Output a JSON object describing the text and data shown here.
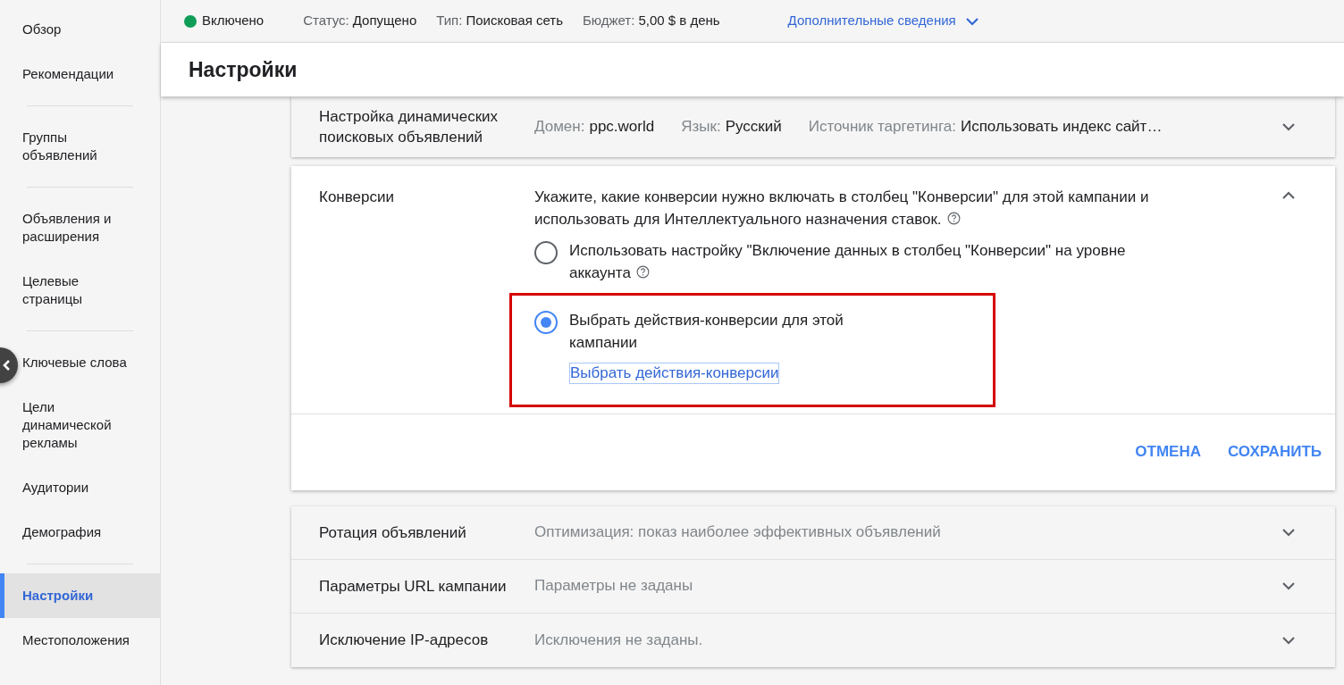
{
  "status_bar": {
    "state": {
      "label": "Включено",
      "color": "#0f9d58"
    },
    "fields": [
      {
        "label": "Статус:",
        "value": "Допущено"
      },
      {
        "label": "Тип:",
        "value": "Поисковая сеть"
      },
      {
        "label": "Бюджет:",
        "value": "5,00 $ в день"
      }
    ],
    "more_link": "Дополнительные сведения"
  },
  "sidebar": {
    "groups": [
      [
        {
          "label": "Обзор",
          "selected": false
        },
        {
          "label": "Рекомендации",
          "selected": false
        }
      ],
      [
        {
          "label": "Группы объявлений",
          "selected": false
        }
      ],
      [
        {
          "label": "Объявления и расширения",
          "selected": false
        },
        {
          "label": "Целевые страницы",
          "selected": false
        }
      ],
      [
        {
          "label": "Ключевые слова",
          "selected": false
        },
        {
          "label": "Цели динамической рекламы",
          "selected": false
        },
        {
          "label": "Аудитории",
          "selected": false
        },
        {
          "label": "Демография",
          "selected": false
        }
      ],
      [
        {
          "label": "Настройки",
          "selected": true
        },
        {
          "label": "Местоположения",
          "selected": false
        }
      ]
    ]
  },
  "page_title": "Настройки",
  "sections": [
    {
      "kind": "summary",
      "title": "Настройка динамических поисковых объявлений",
      "fields": [
        {
          "label": "Домен:",
          "value": "ppc.world"
        },
        {
          "label": "Язык:",
          "value": "Русский"
        },
        {
          "label": "Источник таргетинга:",
          "value": "Использовать индекс сайт…"
        }
      ],
      "expanded": false
    },
    {
      "kind": "editor",
      "title": "Конверсии",
      "description": "Укажите, какие конверсии нужно включать в столбец \"Конверсии\" для этой кампании и использовать для Интеллектуального назначения ставок.",
      "description_help": true,
      "options": [
        {
          "label": "Использовать настройку \"Включение данных в столбец \"Конверсии\" на уровне аккаунта",
          "help": true,
          "selected": false,
          "highlighted": false
        },
        {
          "label": "Выбрать действия-конверсии для этой кампании",
          "help": false,
          "selected": true,
          "highlighted": true,
          "link": "Выбрать действия-конверсии"
        }
      ],
      "buttons": [
        "ОТМЕНА",
        "СОХРАНИТЬ"
      ],
      "expanded": true
    },
    {
      "kind": "summary",
      "title": "Ротация объявлений",
      "text": "Оптимизация: показ наиболее эффективных объявлений",
      "expanded": false
    },
    {
      "kind": "summary",
      "title": "Параметры URL кампании",
      "text": "Параметры не заданы",
      "expanded": false
    },
    {
      "kind": "summary",
      "title": "Исключение IP-адресов",
      "text": "Исключения не заданы.",
      "expanded": false
    }
  ]
}
